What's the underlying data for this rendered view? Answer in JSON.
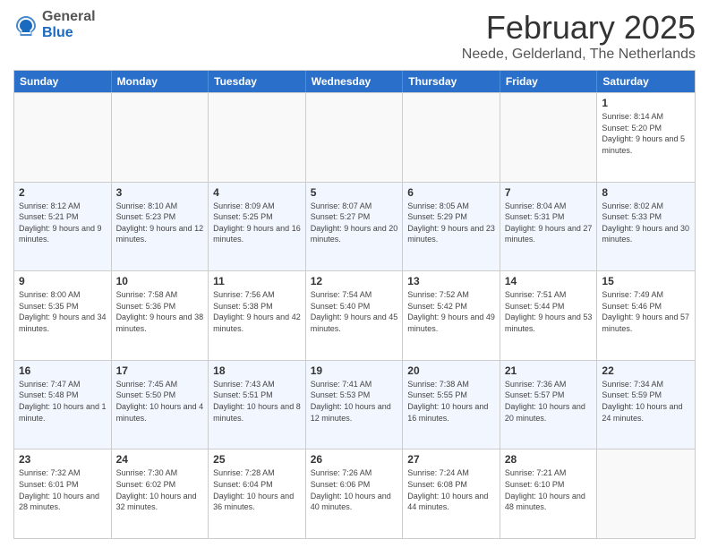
{
  "header": {
    "logo_general": "General",
    "logo_blue": "Blue",
    "main_title": "February 2025",
    "subtitle": "Neede, Gelderland, The Netherlands"
  },
  "calendar": {
    "days_of_week": [
      "Sunday",
      "Monday",
      "Tuesday",
      "Wednesday",
      "Thursday",
      "Friday",
      "Saturday"
    ],
    "weeks": [
      [
        {
          "day": "",
          "info": "",
          "empty": true
        },
        {
          "day": "",
          "info": "",
          "empty": true
        },
        {
          "day": "",
          "info": "",
          "empty": true
        },
        {
          "day": "",
          "info": "",
          "empty": true
        },
        {
          "day": "",
          "info": "",
          "empty": true
        },
        {
          "day": "",
          "info": "",
          "empty": true
        },
        {
          "day": "1",
          "info": "Sunrise: 8:14 AM\nSunset: 5:20 PM\nDaylight: 9 hours and 5 minutes."
        }
      ],
      [
        {
          "day": "2",
          "info": "Sunrise: 8:12 AM\nSunset: 5:21 PM\nDaylight: 9 hours and 9 minutes."
        },
        {
          "day": "3",
          "info": "Sunrise: 8:10 AM\nSunset: 5:23 PM\nDaylight: 9 hours and 12 minutes."
        },
        {
          "day": "4",
          "info": "Sunrise: 8:09 AM\nSunset: 5:25 PM\nDaylight: 9 hours and 16 minutes."
        },
        {
          "day": "5",
          "info": "Sunrise: 8:07 AM\nSunset: 5:27 PM\nDaylight: 9 hours and 20 minutes."
        },
        {
          "day": "6",
          "info": "Sunrise: 8:05 AM\nSunset: 5:29 PM\nDaylight: 9 hours and 23 minutes."
        },
        {
          "day": "7",
          "info": "Sunrise: 8:04 AM\nSunset: 5:31 PM\nDaylight: 9 hours and 27 minutes."
        },
        {
          "day": "8",
          "info": "Sunrise: 8:02 AM\nSunset: 5:33 PM\nDaylight: 9 hours and 30 minutes."
        }
      ],
      [
        {
          "day": "9",
          "info": "Sunrise: 8:00 AM\nSunset: 5:35 PM\nDaylight: 9 hours and 34 minutes."
        },
        {
          "day": "10",
          "info": "Sunrise: 7:58 AM\nSunset: 5:36 PM\nDaylight: 9 hours and 38 minutes."
        },
        {
          "day": "11",
          "info": "Sunrise: 7:56 AM\nSunset: 5:38 PM\nDaylight: 9 hours and 42 minutes."
        },
        {
          "day": "12",
          "info": "Sunrise: 7:54 AM\nSunset: 5:40 PM\nDaylight: 9 hours and 45 minutes."
        },
        {
          "day": "13",
          "info": "Sunrise: 7:52 AM\nSunset: 5:42 PM\nDaylight: 9 hours and 49 minutes."
        },
        {
          "day": "14",
          "info": "Sunrise: 7:51 AM\nSunset: 5:44 PM\nDaylight: 9 hours and 53 minutes."
        },
        {
          "day": "15",
          "info": "Sunrise: 7:49 AM\nSunset: 5:46 PM\nDaylight: 9 hours and 57 minutes."
        }
      ],
      [
        {
          "day": "16",
          "info": "Sunrise: 7:47 AM\nSunset: 5:48 PM\nDaylight: 10 hours and 1 minute."
        },
        {
          "day": "17",
          "info": "Sunrise: 7:45 AM\nSunset: 5:50 PM\nDaylight: 10 hours and 4 minutes."
        },
        {
          "day": "18",
          "info": "Sunrise: 7:43 AM\nSunset: 5:51 PM\nDaylight: 10 hours and 8 minutes."
        },
        {
          "day": "19",
          "info": "Sunrise: 7:41 AM\nSunset: 5:53 PM\nDaylight: 10 hours and 12 minutes."
        },
        {
          "day": "20",
          "info": "Sunrise: 7:38 AM\nSunset: 5:55 PM\nDaylight: 10 hours and 16 minutes."
        },
        {
          "day": "21",
          "info": "Sunrise: 7:36 AM\nSunset: 5:57 PM\nDaylight: 10 hours and 20 minutes."
        },
        {
          "day": "22",
          "info": "Sunrise: 7:34 AM\nSunset: 5:59 PM\nDaylight: 10 hours and 24 minutes."
        }
      ],
      [
        {
          "day": "23",
          "info": "Sunrise: 7:32 AM\nSunset: 6:01 PM\nDaylight: 10 hours and 28 minutes."
        },
        {
          "day": "24",
          "info": "Sunrise: 7:30 AM\nSunset: 6:02 PM\nDaylight: 10 hours and 32 minutes."
        },
        {
          "day": "25",
          "info": "Sunrise: 7:28 AM\nSunset: 6:04 PM\nDaylight: 10 hours and 36 minutes."
        },
        {
          "day": "26",
          "info": "Sunrise: 7:26 AM\nSunset: 6:06 PM\nDaylight: 10 hours and 40 minutes."
        },
        {
          "day": "27",
          "info": "Sunrise: 7:24 AM\nSunset: 6:08 PM\nDaylight: 10 hours and 44 minutes."
        },
        {
          "day": "28",
          "info": "Sunrise: 7:21 AM\nSunset: 6:10 PM\nDaylight: 10 hours and 48 minutes."
        },
        {
          "day": "",
          "info": "",
          "empty": true
        }
      ]
    ]
  }
}
